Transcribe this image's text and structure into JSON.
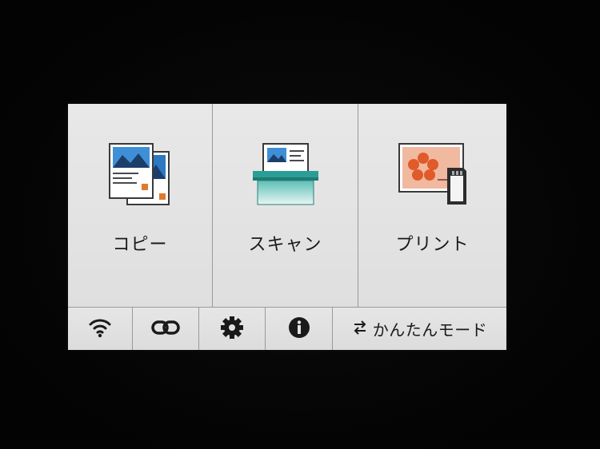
{
  "main": {
    "tiles": [
      {
        "label": "コピー",
        "icon": "copy-documents-icon"
      },
      {
        "label": "スキャン",
        "icon": "scanner-icon"
      },
      {
        "label": "プリント",
        "icon": "photo-print-memory-card-icon"
      }
    ]
  },
  "bottom_bar": {
    "items": [
      {
        "icon": "wifi-icon"
      },
      {
        "icon": "link-icon"
      },
      {
        "icon": "gear-icon"
      },
      {
        "icon": "info-icon"
      }
    ],
    "mode_switch": {
      "icon": "switch-arrows-icon",
      "label": "かんたんモード"
    }
  },
  "colors": {
    "accent_teal": "#2aa39a",
    "accent_orange": "#e05a2a",
    "accent_blue": "#1f6fb5",
    "screen_bg": "#e4e4e4"
  }
}
